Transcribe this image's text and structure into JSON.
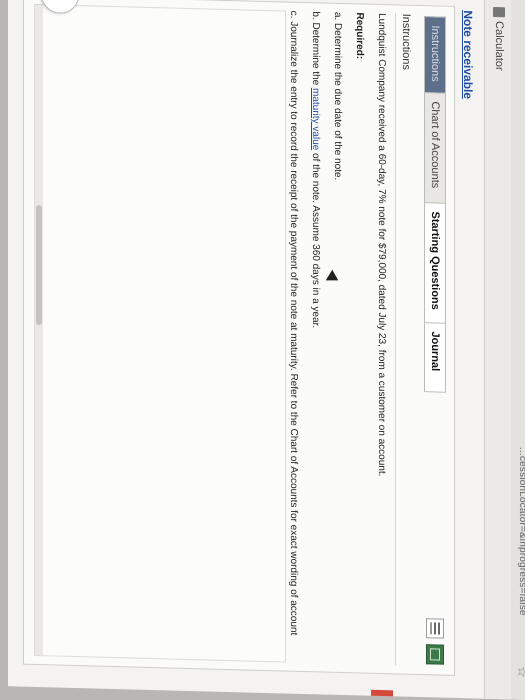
{
  "browser": {
    "url_fragment": "...cessionLocator=&inprogress=false",
    "star_icon": "star-icon"
  },
  "toolbar": {
    "calculator_label": "Calculator",
    "calculator_icon": "calculator-icon"
  },
  "page": {
    "title": "Note receivable"
  },
  "tabs": [
    {
      "label": "Instructions",
      "active": true
    },
    {
      "label": "Chart of Accounts",
      "active": false
    },
    {
      "label": "Starting Questions",
      "active": false
    },
    {
      "label": "Journal",
      "active": false
    }
  ],
  "instructions": {
    "heading": "Instructions",
    "intro": "Lundquist Company received a 60-day, 7% note for $79,000, dated July 23, from a customer on account.",
    "required_label": "Required:",
    "item_a": "a. Determine the due date of the note.",
    "item_b_pre": "b. Determine the ",
    "item_b_link": "maturity value",
    "item_b_post": " of the note. Assume 360 days in a year.",
    "item_c": "c. Journalize the entry to record the receipt of the payment of the note at maturity. Refer to the Chart of Accounts for exact wording of account titles."
  },
  "colors": {
    "active_tab_bg": "#5d6f8a",
    "link": "#1f4ea3",
    "alert_edge": "#d4493b"
  }
}
